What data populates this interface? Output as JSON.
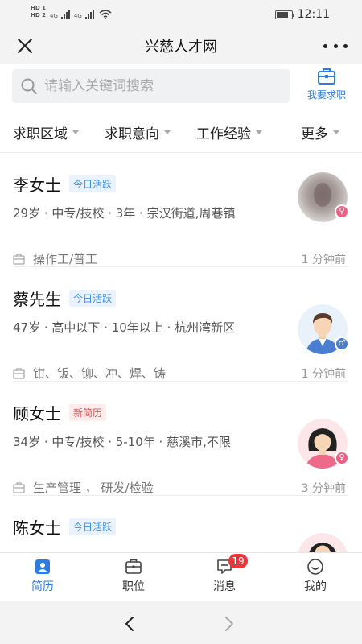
{
  "status_bar": {
    "left_label_top": "HD 1",
    "left_label_bottom": "HD 2",
    "net1": "4G",
    "net2": "4G",
    "time": "12:11"
  },
  "header": {
    "title": "兴慈人才网",
    "close_icon": "close-icon",
    "more_icon": "more-icon"
  },
  "search": {
    "placeholder": "请输入关键词搜索",
    "job_button_label": "我要求职"
  },
  "filters": [
    {
      "label": "求职区域"
    },
    {
      "label": "求职意向"
    },
    {
      "label": "工作经验"
    },
    {
      "label": "更多"
    }
  ],
  "candidates": [
    {
      "name": "李女士",
      "badge": "今日活跃",
      "badge_type": "active",
      "info": "29岁 · 中专/技校 · 3年 · 宗汉街道,周巷镇",
      "job": "操作工/普工",
      "time": "1 分钟前",
      "gender": "female"
    },
    {
      "name": "蔡先生",
      "badge": "今日活跃",
      "badge_type": "active",
      "info": "47岁 · 高中以下 · 10年以上 · 杭州湾新区",
      "job": "钳、钣、铆、冲、焊、铸",
      "time": "1 分钟前",
      "gender": "male"
    },
    {
      "name": "顾女士",
      "badge": "新简历",
      "badge_type": "new",
      "info": "34岁 · 中专/技校 · 5-10年 · 慈溪市,不限",
      "job": "生产管理 ，  研发/检验",
      "time": "3 分钟前",
      "gender": "female"
    },
    {
      "name": "陈女士",
      "badge": "今日活跃",
      "badge_type": "active",
      "gender": "female"
    }
  ],
  "bottom_nav": [
    {
      "label": "简历",
      "active": true
    },
    {
      "label": "职位"
    },
    {
      "label": "消息",
      "badge": "19"
    },
    {
      "label": "我的"
    }
  ],
  "colors": {
    "accent": "#2d7ce6",
    "badge_red": "#e8363a",
    "female": "#ee5f86",
    "male": "#4a7ed1"
  }
}
